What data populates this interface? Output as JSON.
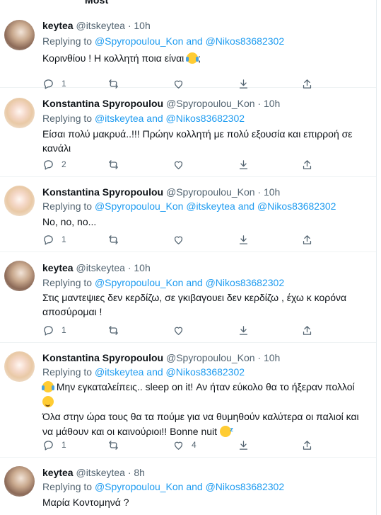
{
  "header_fragment": "Most",
  "tweets": [
    {
      "name": "keytea",
      "handle": "@itskeytea",
      "time": "· 10h",
      "replying_label": "Replying to",
      "replying_to": "@Spyropoulou_Kon and @Nikos83682302",
      "text_lines": [
        "Κορινθίου ! Η κολλητή ποια είναι",
        ";"
      ],
      "emoji": "tears-of-joy-emoji",
      "replies": "1",
      "retweets": "",
      "likes": ""
    },
    {
      "name": "Konstantina Spyropoulou",
      "handle": "@Spyropoulou_Kon",
      "time": "· 10h",
      "replying_label": "Replying to",
      "replying_to": "@itskeytea and @Nikos83682302",
      "text_lines": [
        "Είσαι πολύ μακρυά..!!! Πρώην κολλητή με πολύ εξουσία και επιρροή σε",
        "κανάλι"
      ],
      "replies": "2",
      "retweets": "",
      "likes": ""
    },
    {
      "name": "Konstantina Spyropoulou",
      "handle": "@Spyropoulou_Kon",
      "time": "· 10h",
      "replying_label": "Replying to",
      "replying_to": "@Spyropoulou_Kon @itskeytea and @Nikos83682302",
      "text_lines": [
        "No, no, no..."
      ],
      "replies": "1",
      "retweets": "",
      "likes": ""
    },
    {
      "name": "keytea",
      "handle": "@itskeytea",
      "time": "· 10h",
      "replying_label": "Replying to",
      "replying_to": "@Spyropoulou_Kon and @Nikos83682302",
      "text_lines": [
        "Στις μαντεψιες δεν κερδίζω, σε γκιβαγουει δεν κερδίζω , έχω κ κορόνα",
        "αποσύρομαι !"
      ],
      "replies": "1",
      "retweets": "",
      "likes": ""
    },
    {
      "name": "Konstantina Spyropoulou",
      "handle": "@Spyropoulou_Kon",
      "time": "· 10h",
      "replying_label": "Replying to",
      "replying_to": "@itskeytea and @Nikos83682302",
      "text_lines": [
        "Μην εγκαταλείπεις.. sleep on it! Αν ήταν εύκολο θα το ήξεραν πολλοί",
        "Όλα στην ώρα τους θα τα πούμε για να θυμηθούν καλύτερα οι παλιοί και",
        "να μάθουν και οι καινούριοι!! Bonne nuit"
      ],
      "replies": "1",
      "retweets": "",
      "likes": "4"
    },
    {
      "name": "keytea",
      "handle": "@itskeytea",
      "time": "· 8h",
      "replying_label": "Replying to",
      "replying_to": "@Spyropoulou_Kon and @Nikos83682302",
      "text_lines": [
        "Μαρία Κοντομηνά ?"
      ],
      "replies": "",
      "retweets": "",
      "likes": ""
    }
  ],
  "colors": {
    "link": "#1d9bf0",
    "muted": "#536471",
    "text": "#0f1419"
  }
}
